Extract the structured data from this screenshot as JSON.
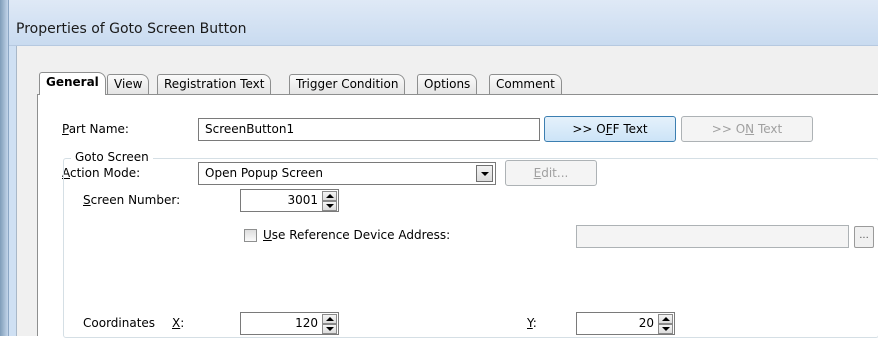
{
  "window": {
    "title": "Properties of Goto Screen Button"
  },
  "tabs": [
    {
      "label": "General",
      "active": true
    },
    {
      "label": "View",
      "active": false
    },
    {
      "label": "Registration Text",
      "active": false
    },
    {
      "label": "Trigger Condition",
      "active": false
    },
    {
      "label": "Options",
      "active": false
    },
    {
      "label": "Comment",
      "active": false
    }
  ],
  "general": {
    "part_name": {
      "label_ul": "P",
      "label_rest": "art Name:",
      "value": "ScreenButton1"
    },
    "off_text_button": {
      "pre": ">> O",
      "ul": "F",
      "post": "F Text"
    },
    "on_text_button": {
      "pre": ">> O",
      "ul": "N",
      "post": " Text"
    },
    "action_mode": {
      "label_ul": "A",
      "label_rest": "ction Mode:",
      "value": "Open Popup Screen"
    },
    "edit_button": {
      "ul": "E",
      "rest": "dit..."
    },
    "goto_screen": {
      "group_title": "Goto Screen",
      "screen_number": {
        "label_ul": "S",
        "label_rest": "creen Number:",
        "value": "3001"
      },
      "use_reference": {
        "label_ul": "U",
        "label_rest": "se Reference Device Address:",
        "checked": false
      },
      "browse_label": "...",
      "coordinates": {
        "label": "Coordinates",
        "x_label_ul": "X",
        "x_label_rest": ":",
        "x_value": "120",
        "y_label_ul": "Y",
        "y_label_rest": ":",
        "y_value": "20"
      }
    }
  }
}
